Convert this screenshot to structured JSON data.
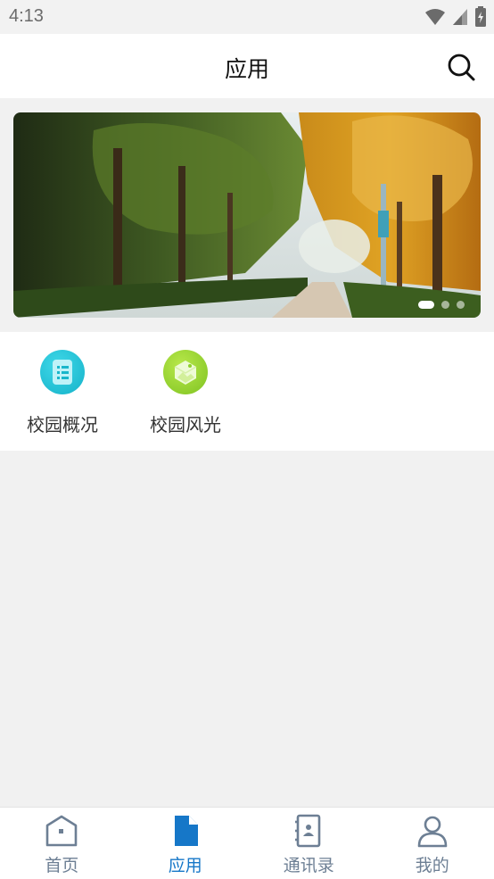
{
  "status_bar": {
    "time": "4:13"
  },
  "header": {
    "title": "应用",
    "search_icon": "search-icon"
  },
  "banner": {
    "slide_count": 3,
    "active_index": 0
  },
  "apps": [
    {
      "label": "校园概况",
      "icon": "list-document-icon",
      "color": "#22c3d6"
    },
    {
      "label": "校园风光",
      "icon": "cube-photo-icon",
      "color": "#8fd12c"
    }
  ],
  "bottom_nav": {
    "items": [
      {
        "label": "首页",
        "icon": "home-icon"
      },
      {
        "label": "应用",
        "icon": "document-icon"
      },
      {
        "label": "通讯录",
        "icon": "contacts-book-icon"
      },
      {
        "label": "我的",
        "icon": "user-icon"
      }
    ],
    "active_index": 1
  },
  "colors": {
    "accent": "#1677c8",
    "inactive": "#6d7f94",
    "background": "#f1f1f1"
  }
}
